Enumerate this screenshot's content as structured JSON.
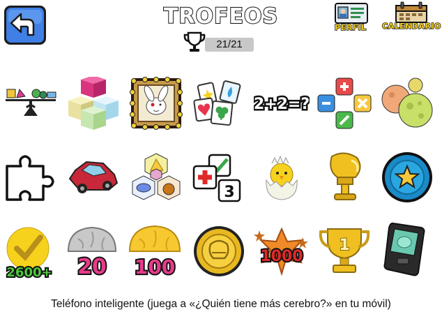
{
  "header": {
    "title": "TROFEOS",
    "count": "21/21",
    "profile_label": "PERFIL",
    "calendar_label": "CALENDARIO"
  },
  "trophies": [
    {
      "name": "balance-scale-trophy"
    },
    {
      "name": "stacked-cubes-trophy"
    },
    {
      "name": "rabbit-portrait-trophy"
    },
    {
      "name": "memory-cards-trophy"
    },
    {
      "name": "math-equation-trophy",
      "text": "2+2=?"
    },
    {
      "name": "math-operators-trophy"
    },
    {
      "name": "planets-trophy"
    },
    {
      "name": "puzzle-piece-trophy"
    },
    {
      "name": "red-car-trophy"
    },
    {
      "name": "food-hexagons-trophy"
    },
    {
      "name": "plus-three-trophy",
      "text": "3"
    },
    {
      "name": "hatching-chick-trophy"
    },
    {
      "name": "golden-glove-trophy"
    },
    {
      "name": "blue-star-medal-trophy"
    },
    {
      "name": "checkmark-2600-trophy",
      "text": "2600+"
    },
    {
      "name": "silver-brain-20-trophy",
      "text": "20"
    },
    {
      "name": "gold-brain-100-trophy",
      "text": "100"
    },
    {
      "name": "gold-glove-coin-trophy"
    },
    {
      "name": "star-1000-trophy",
      "text": "1000"
    },
    {
      "name": "gold-cup-trophy",
      "text": "1"
    },
    {
      "name": "smartphone-trophy"
    }
  ],
  "caption": "Teléfono inteligente (juega a «¿Quién tiene más cerebro?» en tu móvil)"
}
